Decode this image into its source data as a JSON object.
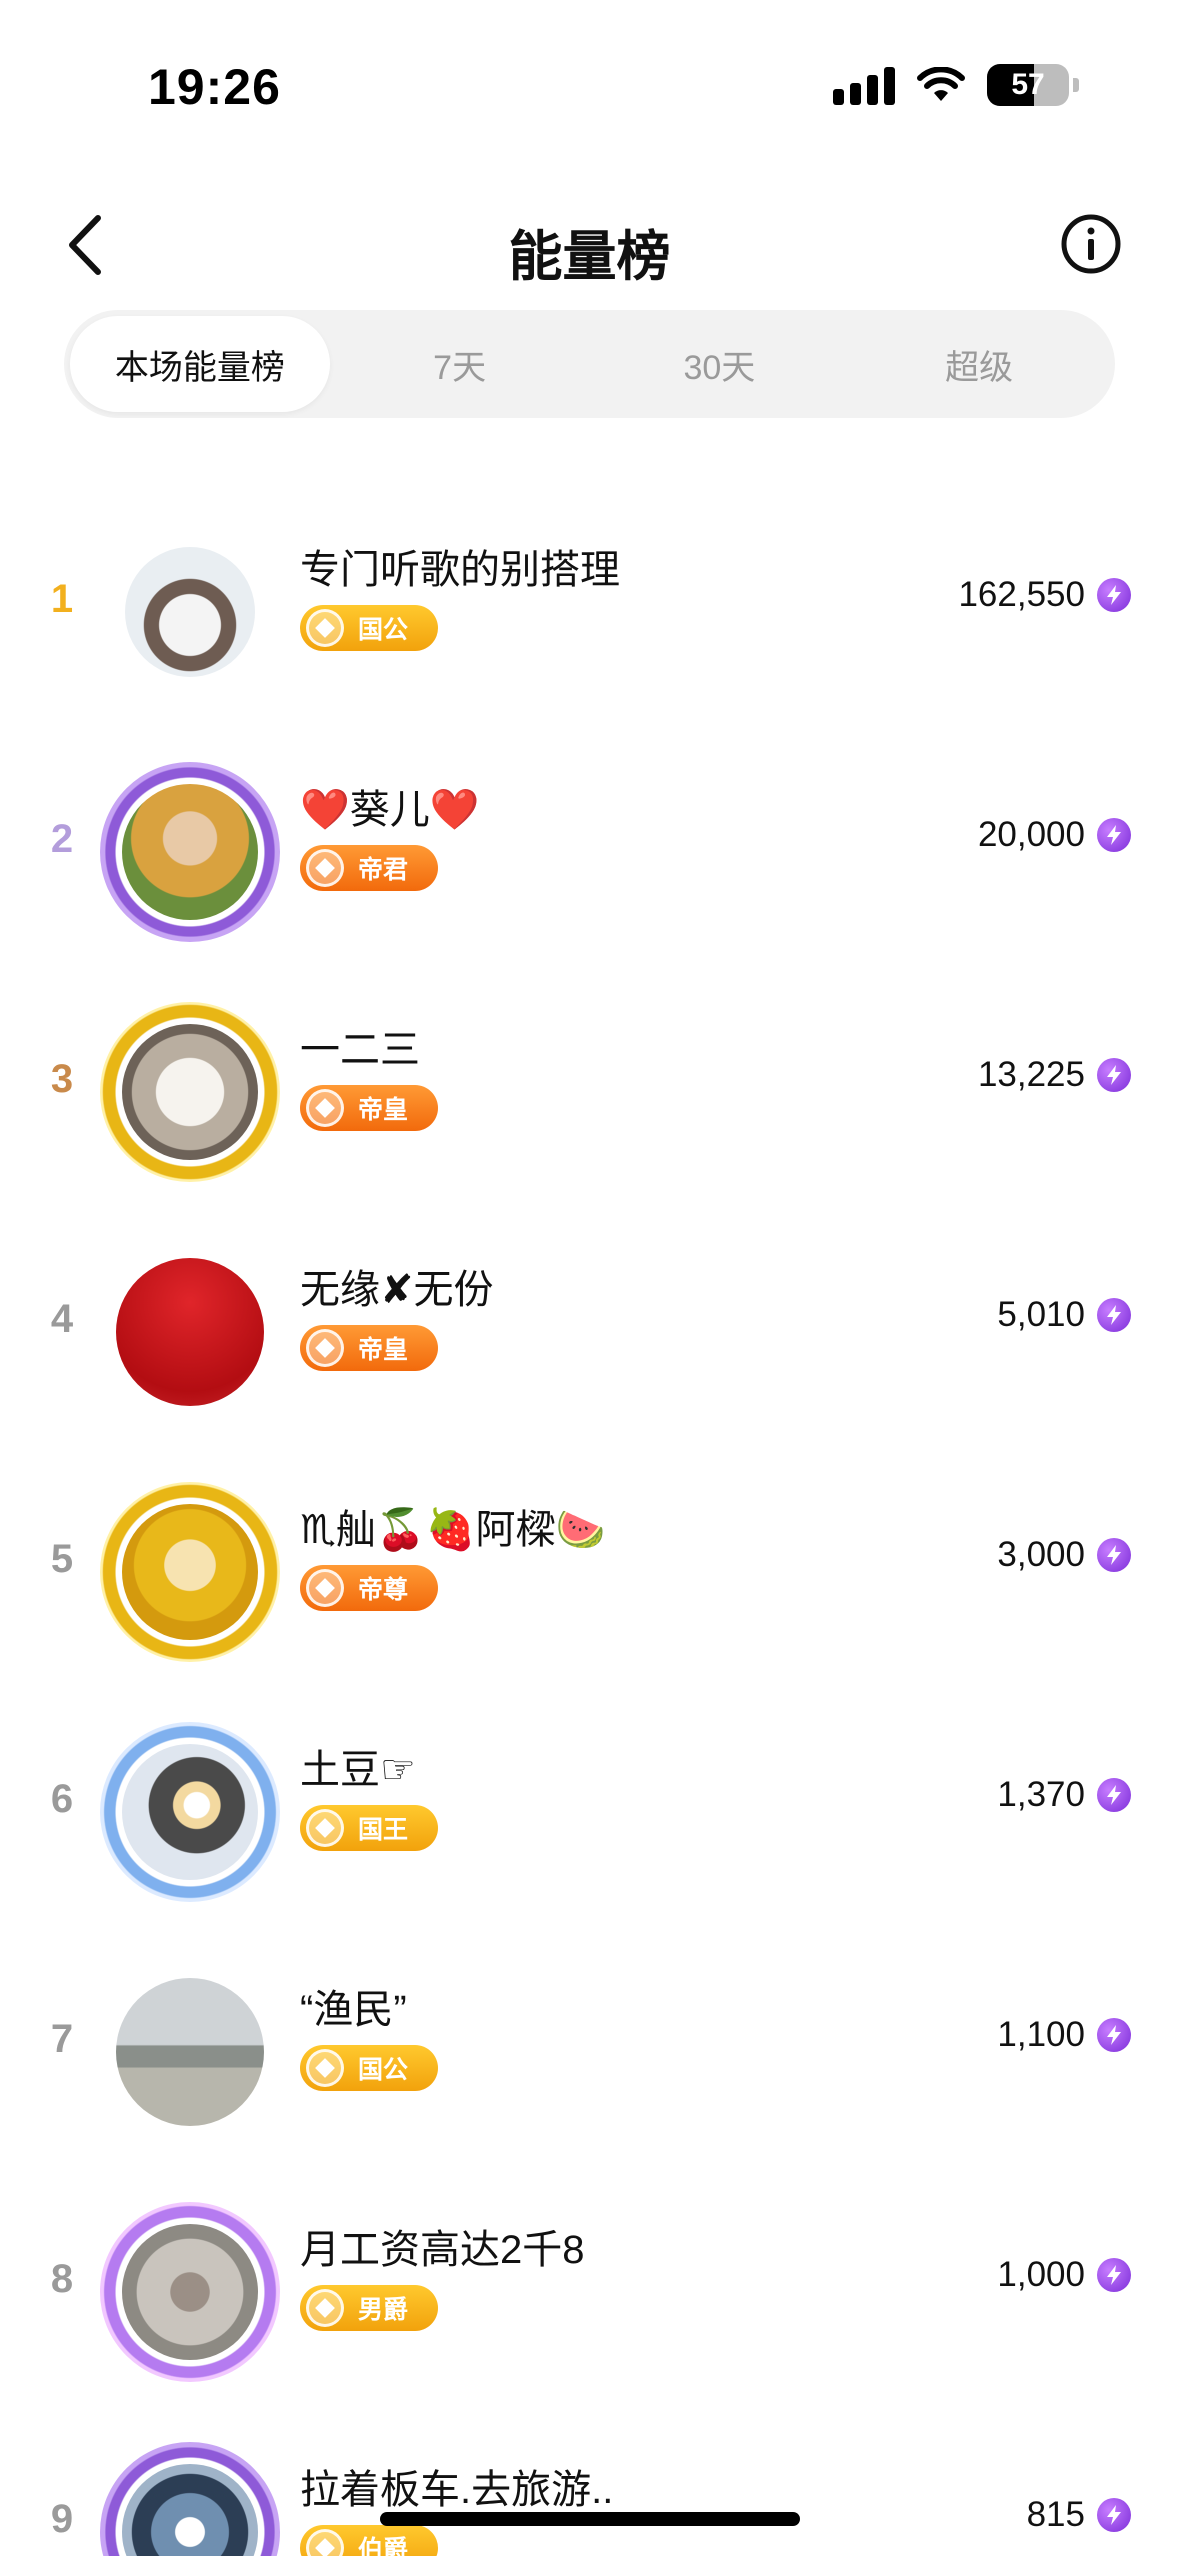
{
  "status_bar": {
    "time": "19:26",
    "battery": "57",
    "battery_level": 0.57
  },
  "nav": {
    "title": "能量榜",
    "back_icon": "chevron-left-icon",
    "info_icon": "info-icon"
  },
  "tabs": [
    {
      "label": "本场能量榜",
      "active": true
    },
    {
      "label": "7天",
      "active": false
    },
    {
      "label": "30天",
      "active": false
    },
    {
      "label": "超级",
      "active": false
    }
  ],
  "currency_icon": "lightning-icon",
  "colors": {
    "rank1": "#f2b01e",
    "rank2": "#b39ddb",
    "rank3": "#c98a4b",
    "rank_other": "#9a9a9a",
    "badge_gold": "#f5a81a",
    "badge_orange": "#f57c1f",
    "currency": "#8a3ffc"
  },
  "leaderboard": [
    {
      "rank": "1",
      "name": "专门听歌的别搭理",
      "badge": "国公",
      "score": "162,550"
    },
    {
      "rank": "2",
      "name": "❤️葵儿❤️",
      "badge": "帝君",
      "score": "20,000"
    },
    {
      "rank": "3",
      "name": "一二三",
      "badge": "帝皇",
      "score": "13,225"
    },
    {
      "rank": "4",
      "name": "无缘✘无份",
      "badge": "帝皇",
      "score": "5,010"
    },
    {
      "rank": "5",
      "name": "♏舢🍒🍓阿樑🍉",
      "badge": "帝尊",
      "score": "3,000"
    },
    {
      "rank": "6",
      "name": "土豆☞",
      "badge": "国王",
      "score": "1,370"
    },
    {
      "rank": "7",
      "name": "“渔民”",
      "badge": "国公",
      "score": "1,100"
    },
    {
      "rank": "8",
      "name": "月工资高达2千8",
      "badge": "男爵",
      "score": "1,000"
    },
    {
      "rank": "9",
      "name": "拉着板车.去旅游..",
      "badge": "伯爵",
      "score": "815"
    }
  ]
}
